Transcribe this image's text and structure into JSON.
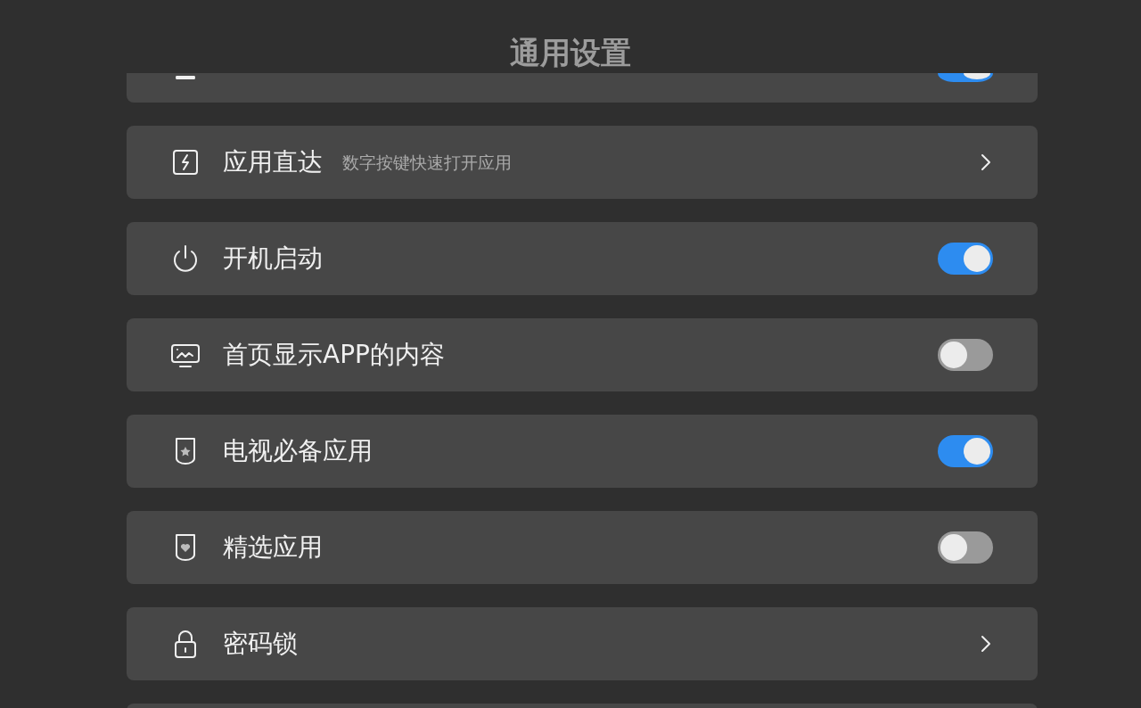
{
  "header": {
    "title": "通用设置"
  },
  "settings": [
    {
      "kind": "toggle",
      "on": true
    },
    {
      "kind": "link",
      "label": "应用直达",
      "description": "数字按键快速打开应用"
    },
    {
      "kind": "toggle",
      "label": "开机启动",
      "on": true
    },
    {
      "kind": "toggle",
      "label": "首页显示APP的内容",
      "on": false
    },
    {
      "kind": "toggle",
      "label": "电视必备应用",
      "on": true
    },
    {
      "kind": "toggle",
      "label": "精选应用",
      "on": false
    },
    {
      "kind": "link",
      "label": "密码锁"
    }
  ]
}
